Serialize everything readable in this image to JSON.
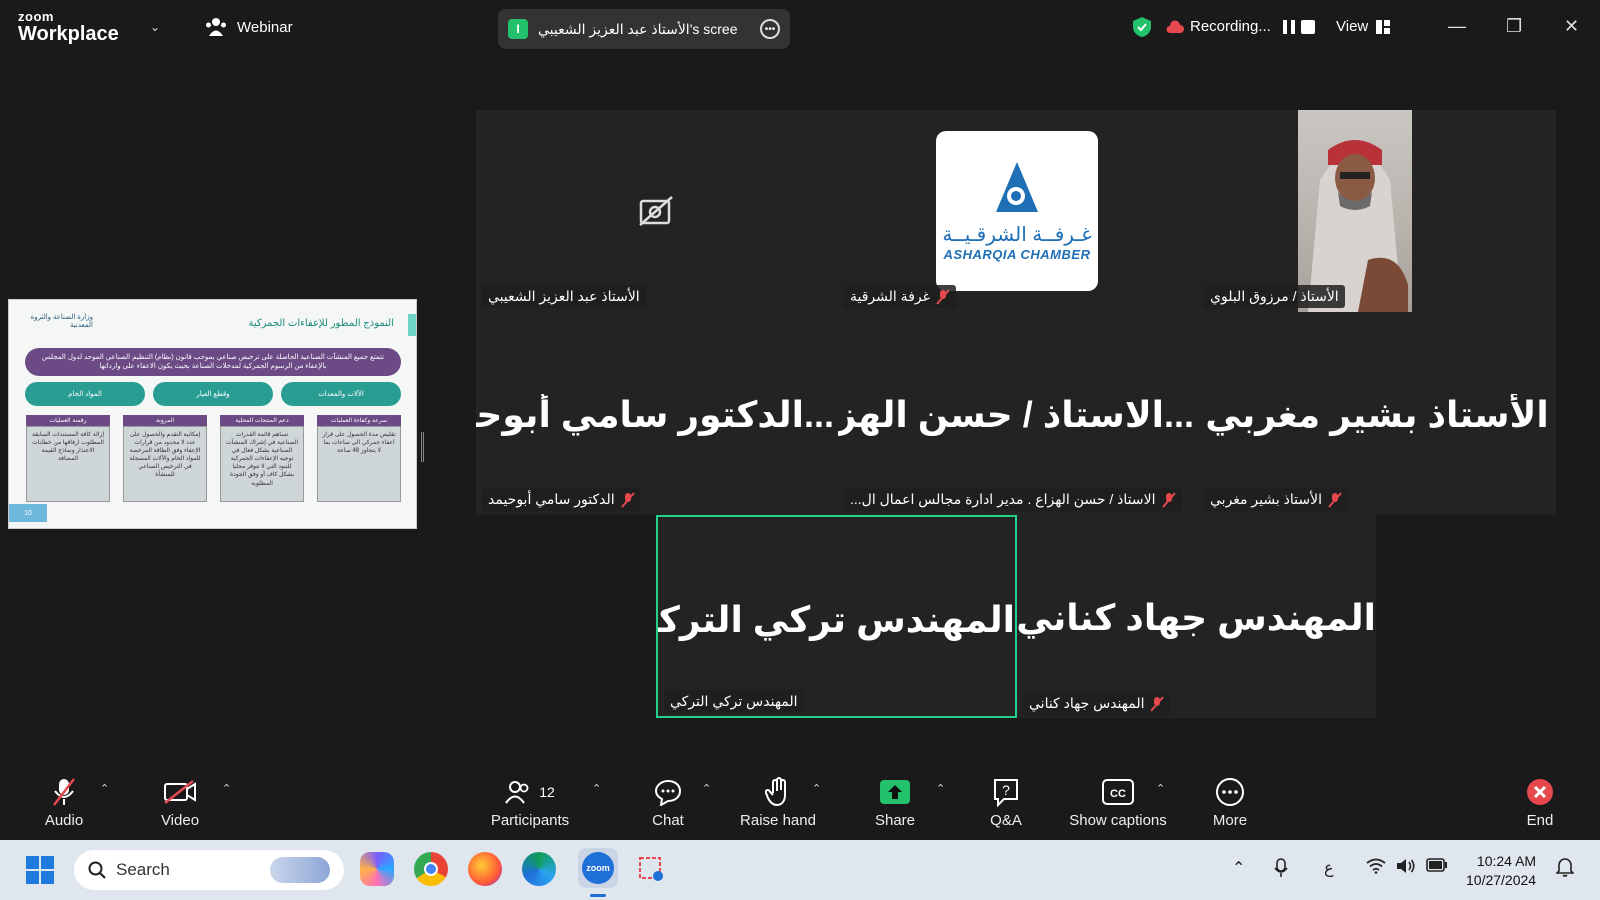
{
  "titlebar": {
    "brand_top": "zoom",
    "brand_bottom": "Workplace",
    "webinar_label": "Webinar",
    "share_badge": "I",
    "share_text": "الأستاذ عبد العزيز الشعيبي's scree",
    "recording_label": "Recording...",
    "view_label": "View"
  },
  "slide": {
    "title": "النموذج المطور للإعفاءات الجمركية",
    "logo_text": "وزارة الصناعة والثروة المعدنية",
    "banner": "تتمتع جميع المنشآت الصناعية الحاصلة على ترخيص صناعي بموجب قانون (نظام) التنظيم الصناعي الموحد لدول المجلس بالإعفاء من الرسوم الجمركية لمدخلات الصناعة بحيث يكون الاعفاء على وارداتها",
    "pills": [
      "الآلات والمعدات",
      "وقطع الغيار",
      "المواد الخام"
    ],
    "columns": [
      {
        "head": "سرعة وكفاءة العمليات",
        "body": "تقليص مدة الحصول على قرار اعفاء جمركي الى ساعات بما لا يتجاوز 48 ساعة"
      },
      {
        "head": "دعم المنتجات المحلية",
        "body": "تساهم قائمة القدرات الصناعية في إشراك المنشآت الصناعية بشكل فعال في توجيه الإعفاءات الجمركية للبنود التي لا تتوفر محليا بشكل كاف أو وفق الجودة المطلوبة"
      },
      {
        "head": "المرونة",
        "body": "إمكانية التقدم والحصول على عدد لا محدود من قرارات الإعفاء وفق الطاقة المرخصة للمواد الخام والآلات المسجلة في الترخيص الصناعي للمنشأة"
      },
      {
        "head": "رقمنة العمليات",
        "body": "إزالة كافة المستندات السابقة المطلوب ارفاقها من خطابات الاعتذار ونماذج القيمة المضافة"
      }
    ],
    "page_number": "10"
  },
  "grid": {
    "tiles": [
      {
        "id": "t1",
        "label": "الأستاذ عبد العزيز الشعيبي",
        "big": "",
        "muted": false
      },
      {
        "id": "t2",
        "label": "غرفة الشرقية",
        "big": "",
        "muted": true
      },
      {
        "id": "t3",
        "label": "الأستاذ / مرزوق البلوي",
        "big": "",
        "muted": false
      },
      {
        "id": "t4",
        "label": "الدكتور سامي أبوحيمد",
        "big": "الدكتور سامي أبوحيمد",
        "muted": true
      },
      {
        "id": "t5",
        "label": "الاستاذ / حسن الهزاع . مدير ادارة مجالس اعمال ال...",
        "big": "الاستاذ / حسن الهزاع",
        "muted": true
      },
      {
        "id": "t6",
        "label": "الأستاذ بشير مغربي",
        "big": "الأستاذ بشير مغربي",
        "muted": true
      }
    ],
    "bottom": [
      {
        "id": "b1",
        "label": "المهندس تركي التركي",
        "big": "المهندس تركي التركي",
        "muted": false
      },
      {
        "id": "b2",
        "label": "المهندس جهاد كناني",
        "big": "المهندس جهاد كناني",
        "muted": true
      }
    ],
    "chamber_ar": "غـرفــة الشرقـيــة",
    "chamber_en": "ASHARQIA CHAMBER",
    "big_t4": "...الدكتور سامي أبوحيـ",
    "big_t5": "...الاستاذ / حسن الهزا",
    "big_t6": "الأستاذ بشير مغربي"
  },
  "toolbar": {
    "audio": "Audio",
    "video": "Video",
    "participants": "Participants",
    "participants_count": "12",
    "chat": "Chat",
    "raise_hand": "Raise hand",
    "share": "Share",
    "qa": "Q&A",
    "captions": "Show captions",
    "more": "More",
    "end": "End"
  },
  "taskbar": {
    "search_placeholder": "Search",
    "input_lang": "ع",
    "time": "10:24 AM",
    "date": "10/27/2024"
  },
  "colors": {
    "accent_green": "#23d18b",
    "mute_red": "#e5484d",
    "share_green": "#23c16b"
  }
}
